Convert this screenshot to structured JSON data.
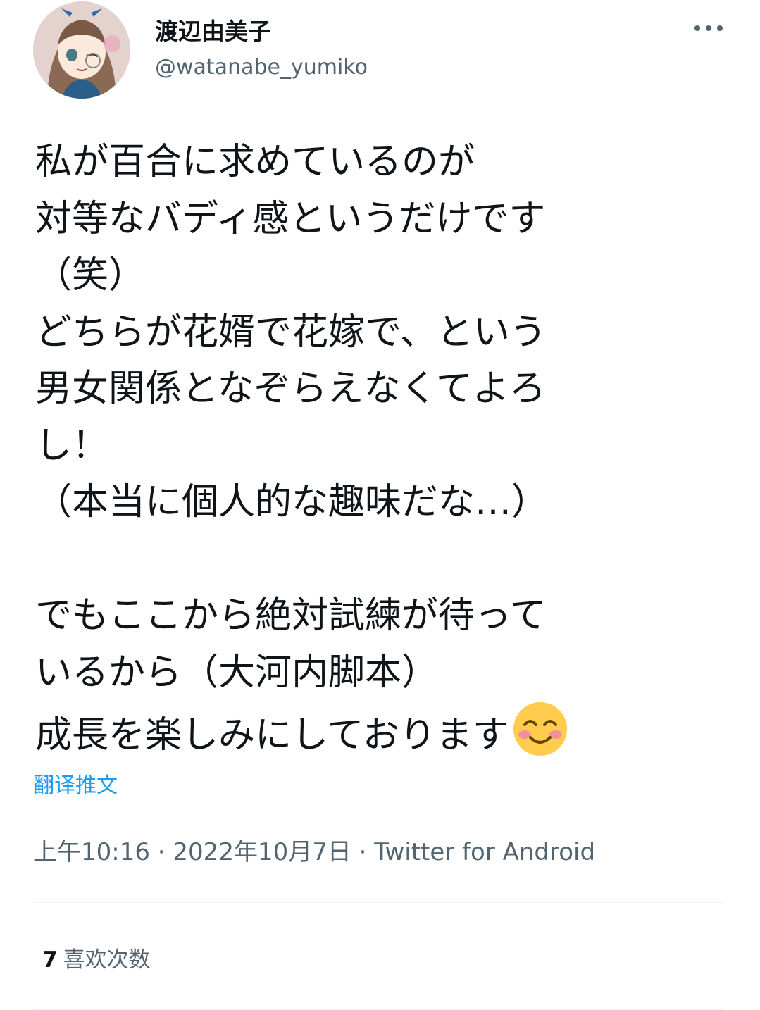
{
  "user": {
    "name": "渡辺由美子",
    "handle": "@watanabe_yumiko",
    "avatar_icon": "anime-girl-avatar-icon"
  },
  "header": {
    "more_icon": "more-options-icon"
  },
  "tweet": {
    "lines": [
      "私が百合に求めているのが",
      "対等なバディ感というだけです",
      "（笑）",
      "どちらが花婿で花嫁で、という",
      "男女関係となぞらえなくてよろ",
      "し！",
      "（本当に個人的な趣味だな…）",
      "",
      "でもここから絶対試練が待って",
      "いるから（大河内脚本）",
      "成長を楽しみにしております"
    ],
    "trailing_emoji": "smiling-face-emoji"
  },
  "translate_label": "翻译推文",
  "meta": {
    "time": "上午10:16",
    "separator": " · ",
    "date": "2022年10月7日",
    "source": "Twitter for Android"
  },
  "stats": {
    "likes_count": "7",
    "likes_label": "喜欢次数"
  },
  "colors": {
    "text": "#0f1419",
    "secondary": "#536471",
    "link": "#1d9bf0",
    "divider": "#eff3f4"
  }
}
